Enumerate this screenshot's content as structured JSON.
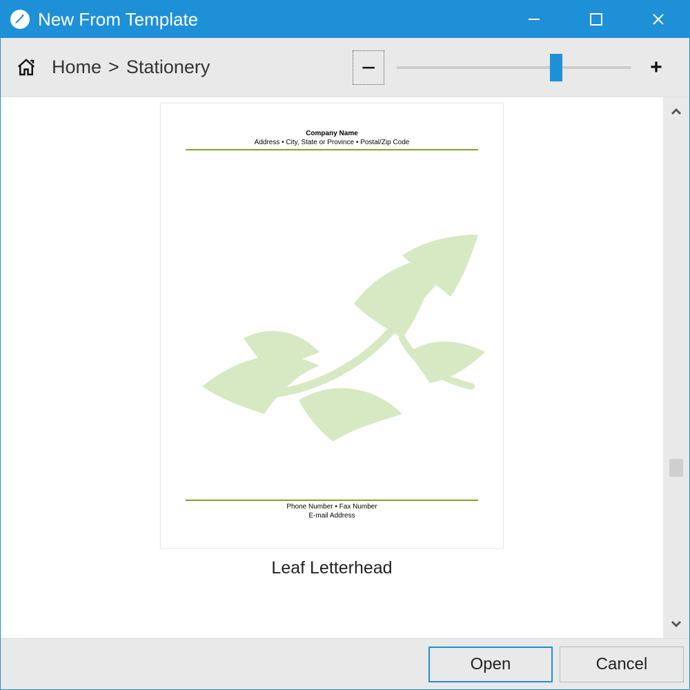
{
  "window": {
    "title": "New From Template"
  },
  "breadcrumb": {
    "root_label": "Home",
    "separator": ">",
    "current_label": "Stationery"
  },
  "zoom": {
    "minus_label": "−",
    "plus_label": "+",
    "slider_percent": 68
  },
  "template": {
    "name": "Leaf Letterhead",
    "preview": {
      "company": "Company Name",
      "address": "Address • City, State or Province • Postal/Zip Code",
      "phone_fax": "Phone Number • Fax Number",
      "email": "E-mail Address"
    }
  },
  "footer": {
    "open_label": "Open",
    "cancel_label": "Cancel"
  },
  "colors": {
    "accent": "#1e90d8",
    "rule": "#7ba81a",
    "leaf": "#d7e9c2"
  }
}
